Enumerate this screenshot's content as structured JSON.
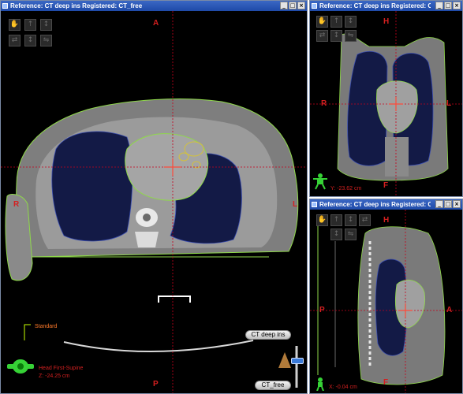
{
  "colors": {
    "titlebar": "#2a58bb",
    "orientation_text": "#d42020",
    "crosshair": "#c8001c",
    "contour_green": "#7fd23a",
    "contour_yellow": "#d4c23a",
    "lung_blue": "#1c2a6b"
  },
  "main_view": {
    "title": "Reference: CT deep ins Registered: CT_free",
    "orientation": {
      "top": "A",
      "bottom": "P",
      "left": "R",
      "right": "L"
    },
    "structure_label": "Standard",
    "position_label": "Head First-Supine",
    "coordinate": "Z: -24.25 cm",
    "blend_top_label": "CT deep ins",
    "blend_bottom_label": "CT_free",
    "tool_icons": [
      "hand-icon",
      "arrow-up-icon",
      "arrow-down-icon",
      "eye-icon"
    ]
  },
  "coronal_view": {
    "title": "Reference: CT deep ins Registered: CT_free",
    "orientation": {
      "top": "H",
      "bottom": "F",
      "left": "R",
      "right": "L"
    },
    "coordinate": "Y: -23.62 cm"
  },
  "sagittal_view": {
    "title": "Reference: CT deep ins Registered: CT_free",
    "orientation": {
      "top": "H",
      "bottom": "F",
      "left": "P",
      "right": "A"
    },
    "coordinate": "X: -0.04 cm"
  },
  "window_buttons": {
    "minimize": "_",
    "maximize": "□",
    "close": "×"
  }
}
